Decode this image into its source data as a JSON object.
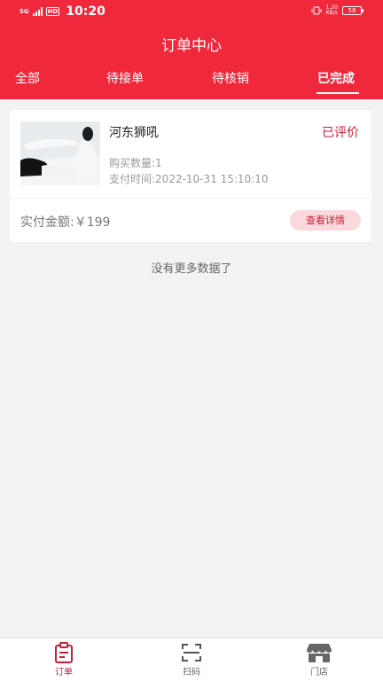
{
  "status_bar": {
    "network": "5G",
    "hd": "HD",
    "time": "10:20",
    "speed_value": "1.20",
    "speed_unit": "KB/s",
    "battery": "58"
  },
  "header": {
    "title": "订单中心"
  },
  "tabs": [
    {
      "label": "全部",
      "active": false
    },
    {
      "label": "待接单",
      "active": false
    },
    {
      "label": "待核销",
      "active": false
    },
    {
      "label": "已完成",
      "active": true
    }
  ],
  "order": {
    "product_name": "河东狮吼",
    "status": "已评价",
    "quantity": "购买数量:1",
    "pay_time": "支付时间:2022-10-31 15:10:10",
    "amount": "实付金额:￥199",
    "detail_button": "查看详情"
  },
  "no_more_text": "没有更多数据了",
  "bottom_nav": [
    {
      "label": "订单",
      "icon": "clipboard-icon",
      "active": true
    },
    {
      "label": "扫码",
      "icon": "scan-icon",
      "active": false
    },
    {
      "label": "门店",
      "icon": "store-icon",
      "active": false
    }
  ],
  "colors": {
    "primary": "#f0283c",
    "accent_text": "#c8203a",
    "button_bg": "#fbd8dc",
    "background": "#f3f3f3"
  }
}
